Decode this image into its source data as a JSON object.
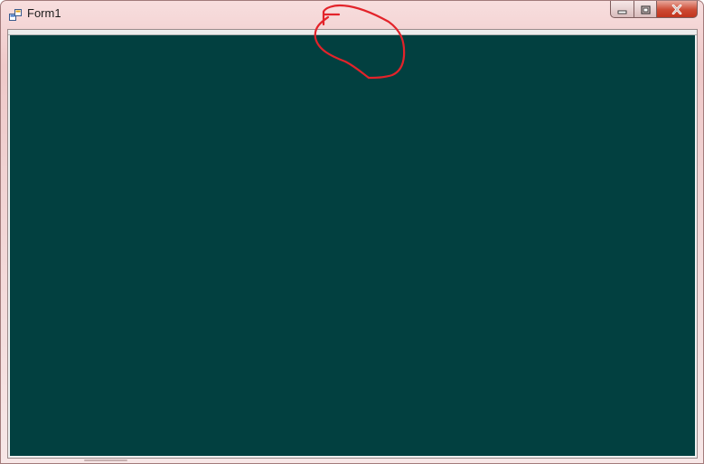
{
  "window": {
    "title": "Form1",
    "icon": "form-app-icon",
    "caption_buttons": [
      {
        "name": "minimize",
        "icon": "minimize-icon"
      },
      {
        "name": "maximize",
        "icon": "maximize-icon"
      },
      {
        "name": "close",
        "icon": "close-icon"
      }
    ]
  },
  "splitter": {
    "icon": "collapse-arrow-down-icon"
  },
  "colors": {
    "panel_background": "#024040",
    "title_bar_tint": "#efc9c9",
    "close_button": "#c9412a",
    "annotation_stroke": "#e3232a"
  },
  "annotation": {
    "icon": "red-circle-annotation"
  }
}
